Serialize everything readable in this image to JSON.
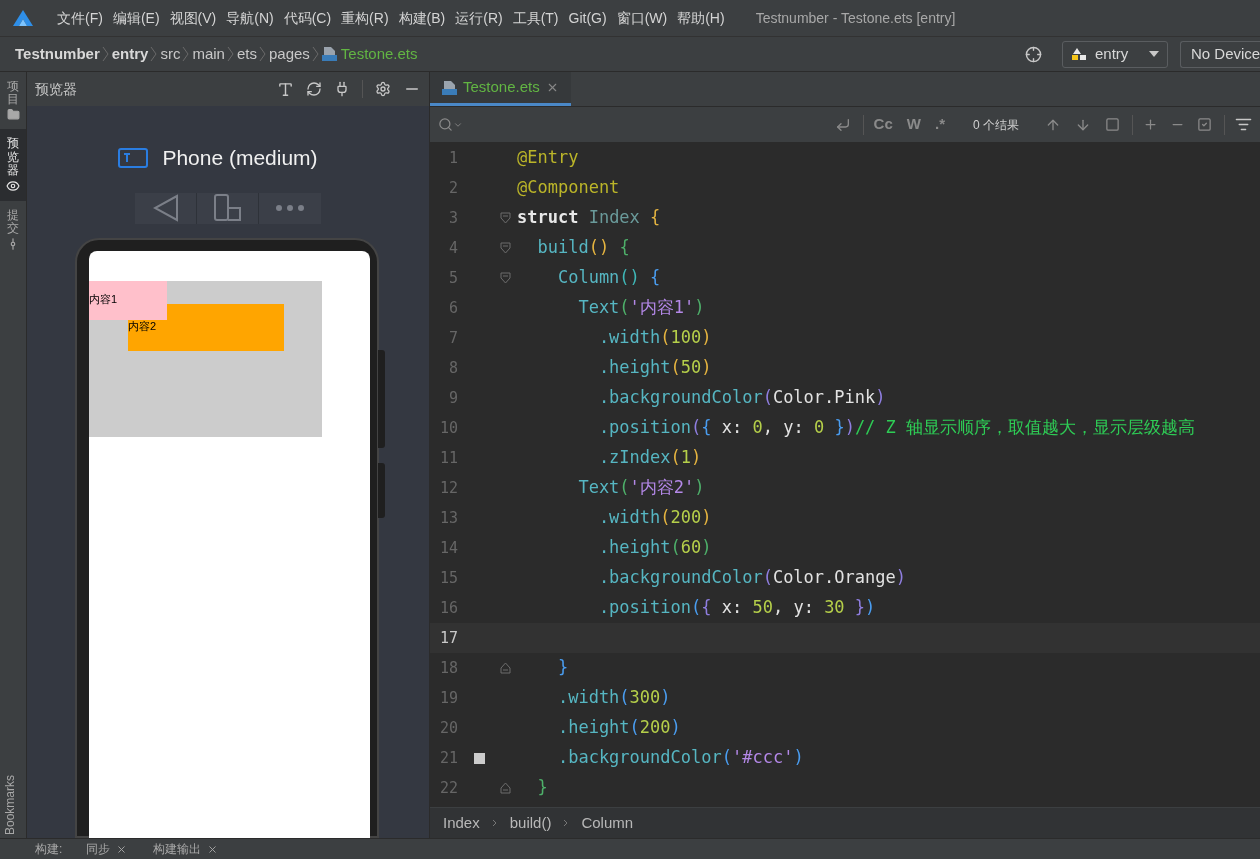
{
  "menu_bar": {
    "items": [
      "文件(F)",
      "编辑(E)",
      "视图(V)",
      "导航(N)",
      "代码(C)",
      "重构(R)",
      "构建(B)",
      "运行(R)",
      "工具(T)",
      "Git(G)",
      "窗口(W)",
      "帮助(H)"
    ],
    "title": "Testnumber - Testone.ets [entry]"
  },
  "breadcrumb": {
    "items": [
      {
        "label": "Testnumber",
        "kind": "bold"
      },
      {
        "label": "entry",
        "kind": "bold"
      },
      {
        "label": "src",
        "kind": "plain"
      },
      {
        "label": "main",
        "kind": "plain"
      },
      {
        "label": "ets",
        "kind": "plain"
      },
      {
        "label": "pages",
        "kind": "plain"
      },
      {
        "label": "Testone.ets",
        "kind": "file"
      }
    ],
    "module": "entry",
    "device": "No Device"
  },
  "side_tabs": [
    {
      "label": "项目",
      "kind": "folder",
      "selected": false
    },
    {
      "label": "预览器",
      "kind": "eye",
      "selected": true
    },
    {
      "label": "提交",
      "kind": "commit",
      "selected": false
    }
  ],
  "side_bottom": "Bookmarks",
  "preview": {
    "title": "预览器",
    "device_name": "Phone (medium)",
    "items": [
      {
        "text": "内容1",
        "color": "#ffc0cb"
      },
      {
        "text": "内容2",
        "color": "#ffa500"
      }
    ]
  },
  "editor": {
    "tab": "Testone.ets",
    "search_tools": [
      "Cc",
      "W",
      ".*"
    ],
    "results": "0 个结果",
    "lines": [
      {
        "number": "1",
        "current": false,
        "fold_open": false,
        "fold_close": false,
        "tokens": [
          {
            "kind": "ann",
            "text": "@Entry"
          }
        ]
      },
      {
        "number": "2",
        "current": false,
        "fold_open": false,
        "fold_close": false,
        "tokens": [
          {
            "kind": "ann",
            "text": "@Component"
          }
        ]
      },
      {
        "number": "3",
        "current": false,
        "fold_open": true,
        "fold_close": false,
        "tokens": [
          {
            "kind": "kw",
            "text": "struct "
          },
          {
            "kind": "type",
            "text": "Index "
          },
          {
            "kind": "p1",
            "text": "{"
          }
        ]
      },
      {
        "number": "4",
        "current": false,
        "fold_open": true,
        "fold_close": false,
        "tokens": [
          {
            "kind": "fn",
            "text": "  build"
          },
          {
            "kind": "p1",
            "text": "() "
          },
          {
            "kind": "p2",
            "text": "{"
          }
        ]
      },
      {
        "number": "5",
        "current": false,
        "fold_open": true,
        "fold_close": false,
        "tokens": [
          {
            "kind": "fn",
            "text": "    Column"
          },
          {
            "kind": "p3",
            "text": "() "
          },
          {
            "kind": "p4",
            "text": "{"
          }
        ]
      },
      {
        "number": "6",
        "current": false,
        "fold_open": false,
        "fold_close": false,
        "tokens": [
          {
            "kind": "fn",
            "text": "      Text"
          },
          {
            "kind": "p2",
            "text": "("
          },
          {
            "kind": "str",
            "text": "'内容1'"
          },
          {
            "kind": "p2",
            "text": ")"
          }
        ]
      },
      {
        "number": "7",
        "current": false,
        "fold_open": false,
        "fold_close": false,
        "tokens": [
          {
            "kind": "fn",
            "text": "        .width"
          },
          {
            "kind": "p1",
            "text": "("
          },
          {
            "kind": "num",
            "text": "100"
          },
          {
            "kind": "p1",
            "text": ")"
          }
        ]
      },
      {
        "number": "8",
        "current": false,
        "fold_open": false,
        "fold_close": false,
        "tokens": [
          {
            "kind": "fn",
            "text": "        .height"
          },
          {
            "kind": "p1",
            "text": "("
          },
          {
            "kind": "num",
            "text": "50"
          },
          {
            "kind": "p1",
            "text": ")"
          }
        ]
      },
      {
        "number": "9",
        "current": false,
        "fold_open": false,
        "fold_close": false,
        "tokens": [
          {
            "kind": "fn",
            "text": "        .backgroundColor"
          },
          {
            "kind": "p5",
            "text": "("
          },
          {
            "kind": "plain",
            "text": "Color.Pink"
          },
          {
            "kind": "p5",
            "text": ")"
          }
        ]
      },
      {
        "number": "10",
        "current": false,
        "fold_open": false,
        "fold_close": false,
        "tokens": [
          {
            "kind": "fn",
            "text": "        .position"
          },
          {
            "kind": "p5",
            "text": "("
          },
          {
            "kind": "p4",
            "text": "{"
          },
          {
            "kind": "plain",
            "text": " x: "
          },
          {
            "kind": "num",
            "text": "0"
          },
          {
            "kind": "plain",
            "text": ", y: "
          },
          {
            "kind": "num",
            "text": "0"
          },
          {
            "kind": "p4",
            "text": " }"
          },
          {
            "kind": "p5",
            "text": ")"
          },
          {
            "kind": "comment",
            "text": "// Z 轴显示顺序，取值越大，显示层级越高"
          }
        ]
      },
      {
        "number": "11",
        "current": false,
        "fold_open": false,
        "fold_close": false,
        "tokens": [
          {
            "kind": "fn",
            "text": "        .zIndex"
          },
          {
            "kind": "p1",
            "text": "("
          },
          {
            "kind": "num",
            "text": "1"
          },
          {
            "kind": "p1",
            "text": ")"
          }
        ]
      },
      {
        "number": "12",
        "current": false,
        "fold_open": false,
        "fold_close": false,
        "tokens": [
          {
            "kind": "fn",
            "text": "      Text"
          },
          {
            "kind": "p2",
            "text": "("
          },
          {
            "kind": "str",
            "text": "'内容2'"
          },
          {
            "kind": "p2",
            "text": ")"
          }
        ]
      },
      {
        "number": "13",
        "current": false,
        "fold_open": false,
        "fold_close": false,
        "tokens": [
          {
            "kind": "fn",
            "text": "        .width"
          },
          {
            "kind": "p1",
            "text": "("
          },
          {
            "kind": "num",
            "text": "200"
          },
          {
            "kind": "p1",
            "text": ")"
          }
        ]
      },
      {
        "number": "14",
        "current": false,
        "fold_open": false,
        "fold_close": false,
        "tokens": [
          {
            "kind": "fn",
            "text": "        .height"
          },
          {
            "kind": "p2",
            "text": "("
          },
          {
            "kind": "num",
            "text": "60"
          },
          {
            "kind": "p2",
            "text": ")"
          }
        ]
      },
      {
        "number": "15",
        "current": false,
        "fold_open": false,
        "fold_close": false,
        "tokens": [
          {
            "kind": "fn",
            "text": "        .backgroundColor"
          },
          {
            "kind": "p5",
            "text": "("
          },
          {
            "kind": "plain",
            "text": "Color.Orange"
          },
          {
            "kind": "p5",
            "text": ")"
          }
        ]
      },
      {
        "number": "16",
        "current": false,
        "fold_open": false,
        "fold_close": false,
        "tokens": [
          {
            "kind": "fn",
            "text": "        .position"
          },
          {
            "kind": "p4",
            "text": "("
          },
          {
            "kind": "p5",
            "text": "{"
          },
          {
            "kind": "plain",
            "text": " x: "
          },
          {
            "kind": "num",
            "text": "50"
          },
          {
            "kind": "plain",
            "text": ", y: "
          },
          {
            "kind": "num",
            "text": "30"
          },
          {
            "kind": "p5",
            "text": " }"
          },
          {
            "kind": "p4",
            "text": ")"
          }
        ]
      },
      {
        "number": "17",
        "current": true,
        "fold_open": false,
        "fold_close": false
      },
      {
        "number": "18",
        "current": false,
        "fold_open": false,
        "fold_close": true,
        "tokens": [
          {
            "kind": "p4",
            "text": "    }"
          }
        ]
      },
      {
        "number": "19",
        "current": false,
        "fold_open": false,
        "fold_close": false,
        "tokens": [
          {
            "kind": "fn",
            "text": "    .width"
          },
          {
            "kind": "p4",
            "text": "("
          },
          {
            "kind": "num",
            "text": "300"
          },
          {
            "kind": "p4",
            "text": ")"
          }
        ]
      },
      {
        "number": "20",
        "current": false,
        "fold_open": false,
        "fold_close": false,
        "tokens": [
          {
            "kind": "fn",
            "text": "    .height"
          },
          {
            "kind": "p4",
            "text": "("
          },
          {
            "kind": "num",
            "text": "200"
          },
          {
            "kind": "p4",
            "text": ")"
          }
        ]
      },
      {
        "number": "21",
        "current": false,
        "fold_open": false,
        "fold_close": false,
        "color": "#cccccc",
        "tokens": [
          {
            "kind": "fn",
            "text": "    .backgroundColor"
          },
          {
            "kind": "p4",
            "text": "("
          },
          {
            "kind": "str",
            "text": "'#ccc'"
          },
          {
            "kind": "p4",
            "text": ")"
          }
        ]
      },
      {
        "number": "22",
        "current": false,
        "fold_open": false,
        "fold_close": true,
        "tokens": [
          {
            "kind": "p2",
            "text": "  }"
          }
        ]
      }
    ],
    "path": [
      "Index",
      "build()",
      "Column"
    ]
  },
  "bottom_bar": {
    "label": "构建:",
    "tabs": [
      "同步",
      "构建输出"
    ]
  }
}
